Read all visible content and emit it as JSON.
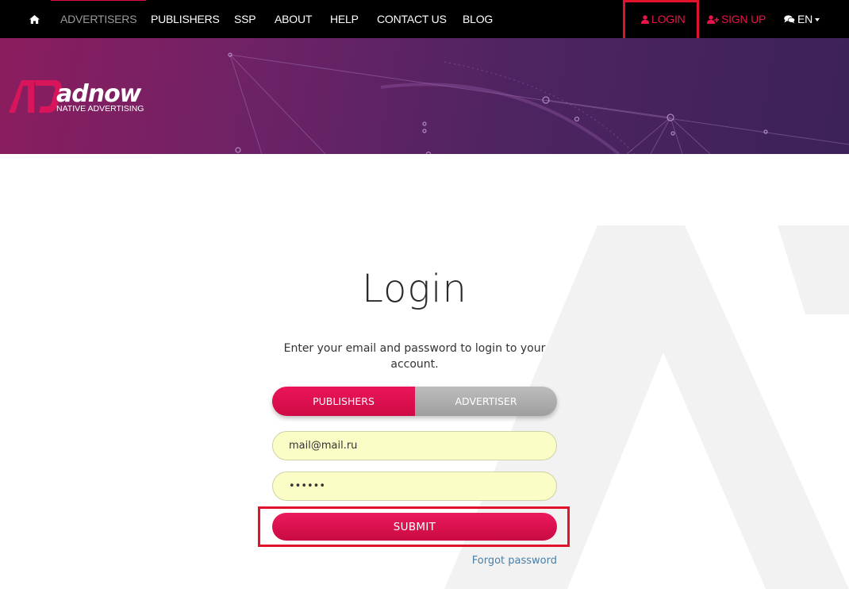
{
  "nav": {
    "home_icon": "home-icon",
    "items": [
      {
        "label": "ADVERTISERS",
        "active": true
      },
      {
        "label": "PUBLISHERS"
      },
      {
        "label": "SSP"
      },
      {
        "label": "ABOUT"
      },
      {
        "label": "HELP"
      },
      {
        "label": "CONTACT US"
      },
      {
        "label": "BLOG"
      }
    ],
    "login_label": "LOGIN",
    "login_icon": "user-icon",
    "signup_label": "SIGN UP",
    "signup_icon": "user-plus-icon",
    "language_label": "EN",
    "language_icon": "comments-icon"
  },
  "banner": {
    "logo_text": "adnow",
    "logo_tagline": "NATIVE ADVERTISING"
  },
  "login": {
    "title": "Login",
    "subtitle": "Enter your email and password to login to your account.",
    "tabs": [
      {
        "label": "PUBLISHERS",
        "selected": true
      },
      {
        "label": "ADVERTISER",
        "selected": false
      }
    ],
    "email_value": "mail@mail.ru",
    "password_value": "••••••",
    "submit_label": "SUBMIT",
    "forgot_label": "Forgot password"
  },
  "colors": {
    "accent": "#e8134a",
    "nav_bg": "#000000",
    "input_bg": "#fbfdc6",
    "highlight": "#e1132b",
    "link": "#4a7fa6"
  }
}
